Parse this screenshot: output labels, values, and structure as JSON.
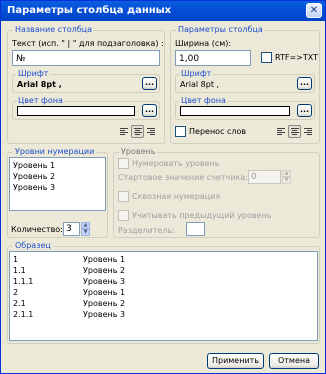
{
  "window": {
    "title": "Параметры столбца данных",
    "close_glyph": "✕"
  },
  "column_name": {
    "title": "Название столбца",
    "text_label": "Текст (исп. \" | \" для подзаголовка) :",
    "text_value": "№",
    "font_title": "Шрифт",
    "font_value": "Arial 8pt ,",
    "bg_title": "Цвет фона",
    "ellipsis": "..."
  },
  "column_params": {
    "title": "Параметры столбца",
    "width_label": "Ширина (см):",
    "width_value": "1,00",
    "rtf_label": "RTF=>TXT",
    "font_title": "Шрифт",
    "font_value": "Arial 8pt ,",
    "bg_title": "Цвет фона",
    "wrap_label": "Перенос слов",
    "ellipsis": "..."
  },
  "numbering_levels": {
    "title": "Уровни нумерации",
    "items": [
      "Уровень 1",
      "Уровень 2",
      "Уровень 3"
    ],
    "count_label": "Количество:",
    "count_value": "3"
  },
  "level": {
    "title": "Уровень",
    "number_level_label": "Нумеровать уровень",
    "start_label": "Стартовое значение счетчика:",
    "start_value": "0",
    "through_label": "Сквозная нумерация",
    "prev_level_label": "Учитывать предыдущий уровень",
    "separator_label": "Разделитель:"
  },
  "sample": {
    "title": "Образец",
    "rows": [
      {
        "num": "1",
        "label": "Уровень 1"
      },
      {
        "num": "1.1",
        "label": "Уровень 2"
      },
      {
        "num": "1.1.1",
        "label": "Уровень 3"
      },
      {
        "num": "2",
        "label": "Уровень 1"
      },
      {
        "num": "2.1",
        "label": "Уровень 2"
      },
      {
        "num": "2.1.1",
        "label": "Уровень 3"
      }
    ]
  },
  "footer": {
    "apply_label": "Применить",
    "cancel_label": "Отмена"
  },
  "colors": {
    "title_bar": "#0550d8",
    "group_title": "#1f4fcf",
    "dialog_bg": "#ece9d8"
  },
  "icons": {
    "align": [
      "align-left-icon",
      "align-center-icon",
      "align-right-icon"
    ],
    "spin": [
      "spin-up-icon",
      "spin-down-icon"
    ]
  }
}
